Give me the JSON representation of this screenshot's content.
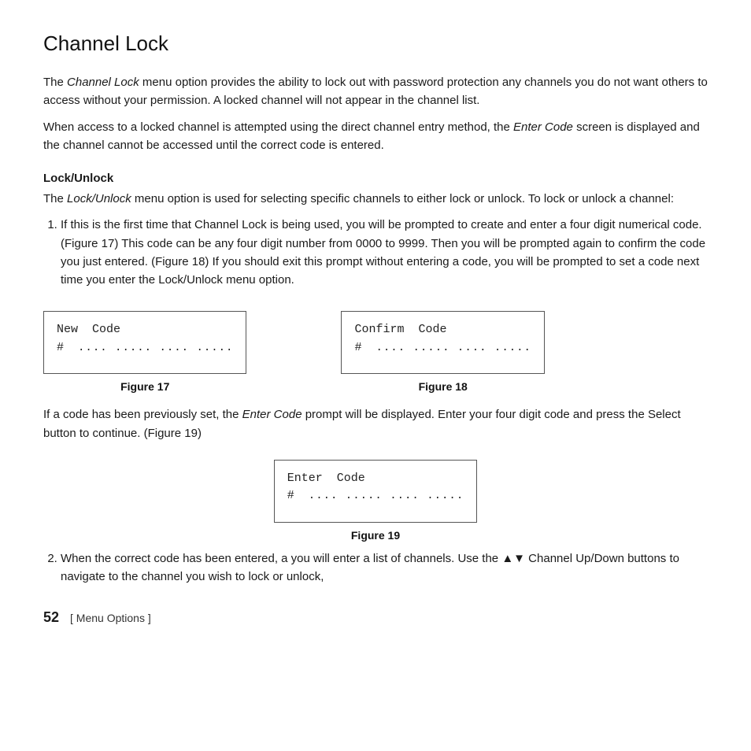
{
  "page": {
    "title": "Channel Lock",
    "intro_paragraphs": [
      "The Channel Lock menu option provides the ability to lock out with password protection any channels you do not want others to access without your permission. A locked channel will not appear in the channel list.",
      "When access to a locked channel is attempted using the direct channel entry method, the Enter Code screen is displayed and the channel cannot be accessed until the correct code is entered."
    ],
    "section_heading": "Lock/Unlock",
    "section_intro": "The Lock/Unlock menu option is used for selecting specific channels to either lock or unlock. To lock or unlock a channel:",
    "list_items": [
      "If this is the first time that Channel Lock is being used, you will be prompted to create and enter a four digit numerical code. (Figure 17) This code can be any four digit number from 0000 to 9999. Then you will be prompted again to confirm the code you just entered. (Figure 18) If you should exit this prompt without entering a code, you will be prompted to set a code next time you enter the Lock/Unlock menu option.",
      "When the correct code has been entered, a you will enter a list of channels. Use the ▲▼ Channel Up/Down buttons to navigate to the channel you wish to lock or unlock,"
    ],
    "figure17": {
      "caption": "Figure 17",
      "lines": [
        "New  Code",
        "#          .... ..... .... ....."
      ]
    },
    "figure18": {
      "caption": "Figure 18",
      "lines": [
        "Confirm  Code",
        "#          .... ..... .... ....."
      ]
    },
    "figure19": {
      "caption": "Figure 19",
      "lines": [
        "Enter  Code",
        "#          .... ..... .... ....."
      ]
    },
    "between_text": "If a code has been previously set, the Enter Code prompt will be displayed. Enter your four digit code and press the Select button to continue. (Figure 19)",
    "footer": {
      "page_number": "52",
      "section": "[ Menu Options ]"
    },
    "italic_terms": {
      "channel_lock": "Channel Lock",
      "enter_code": "Enter Code",
      "lock_unlock": "Lock/Unlock",
      "enter_code2": "Enter Code"
    }
  }
}
